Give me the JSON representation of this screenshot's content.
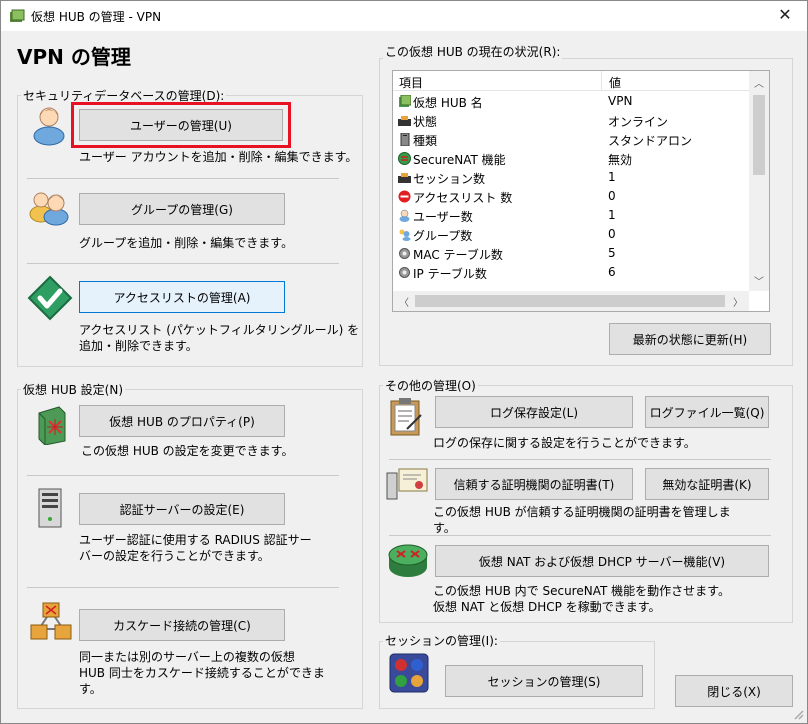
{
  "window": {
    "title": "仮想 HUB の管理 - VPN",
    "close_glyph": "✕"
  },
  "heading": "VPN の管理",
  "security": {
    "legend": "セキュリティデータベースの管理(D):",
    "user_btn": "ユーザーの管理(U)",
    "user_desc": "ユーザー アカウントを追加・削除・編集できます。",
    "group_btn": "グループの管理(G)",
    "group_desc": "グループを追加・削除・編集できます。",
    "access_btn": "アクセスリストの管理(A)",
    "access_desc1": "アクセスリスト (パケットフィルタリングルール) を",
    "access_desc2": "追加・削除できます。"
  },
  "hubsettings": {
    "legend": "仮想 HUB 設定(N)",
    "prop_btn": "仮想 HUB のプロパティ(P)",
    "prop_desc": "この仮想 HUB の設定を変更できます。",
    "auth_btn": "認証サーバーの設定(E)",
    "auth_desc1": "ユーザー認証に使用する RADIUS 認証サー",
    "auth_desc2": "バーの設定を行うことができます。",
    "cascade_btn": "カスケード接続の管理(C)",
    "cascade_desc1": "同一または別のサーバー上の複数の仮想",
    "cascade_desc2": "HUB 同士をカスケード接続することができま",
    "cascade_desc3": "す。"
  },
  "status": {
    "legend": "この仮想 HUB の現在の状況(R):",
    "col_item": "項目",
    "col_value": "値",
    "rows": [
      {
        "k": "仮想 HUB 名",
        "v": "VPN"
      },
      {
        "k": "状態",
        "v": "オンライン"
      },
      {
        "k": "種類",
        "v": "スタンドアロン"
      },
      {
        "k": "SecureNAT 機能",
        "v": "無効"
      },
      {
        "k": "セッション数",
        "v": "1"
      },
      {
        "k": "アクセスリスト 数",
        "v": "0"
      },
      {
        "k": "ユーザー数",
        "v": "1"
      },
      {
        "k": "グループ数",
        "v": "0"
      },
      {
        "k": "MAC テーブル数",
        "v": "5"
      },
      {
        "k": "IP テーブル数",
        "v": "6"
      }
    ],
    "refresh_btn": "最新の状態に更新(H)"
  },
  "other": {
    "legend": "その他の管理(O)",
    "log_btn": "ログ保存設定(L)",
    "logfiles_btn": "ログファイル一覧(Q)",
    "log_desc": "ログの保存に関する設定を行うことができます。",
    "ca_btn": "信頼する証明機関の証明書(T)",
    "crl_btn": "無効な証明書(K)",
    "ca_desc1": "この仮想 HUB が信頼する証明機関の証明書を管理しま",
    "ca_desc2": "す。",
    "nat_btn": "仮想 NAT および仮想 DHCP サーバー機能(V)",
    "nat_desc1": "この仮想 HUB 内で SecureNAT 機能を動作させます。",
    "nat_desc2": "仮想 NAT と仮想 DHCP を稼動できます。"
  },
  "session": {
    "legend": "セッションの管理(I):",
    "btn": "セッションの管理(S)"
  },
  "close_btn": "閉じる(X)",
  "colors": {
    "accent": "#0078d7",
    "highlight": "#e81123",
    "bg": "#f0f0f0"
  }
}
